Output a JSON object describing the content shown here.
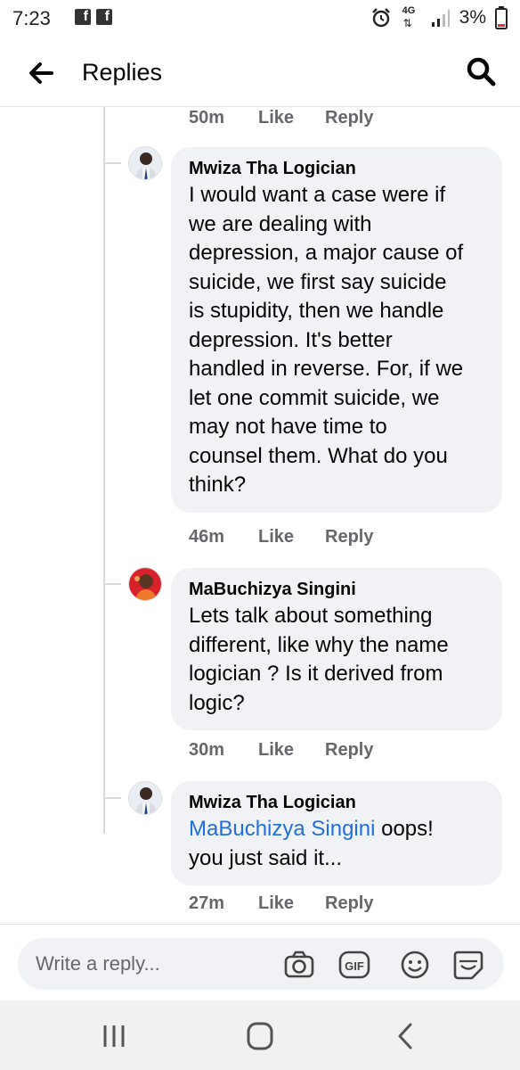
{
  "status_bar": {
    "time": "7:23",
    "network": "4G",
    "battery": "3%"
  },
  "header": {
    "title": "Replies",
    "back_icon": "arrow-left-icon",
    "search_icon": "search-icon"
  },
  "previous_meta": {
    "time": "50m",
    "like": "Like",
    "reply": "Reply"
  },
  "comments": [
    {
      "author": "Mwiza Tha Logician",
      "text": "I would want a case were if\nwe are dealing with\ndepression, a major cause of\nsuicide, we first say suicide\nis stupidity, then we handle\ndepression. It's better\nhandled in reverse. For, if we\nlet one commit suicide, we\nmay not have time to\ncounsel them. What do you\nthink?",
      "time": "46m",
      "like": "Like",
      "reply": "Reply"
    },
    {
      "author": "MaBuchizya Singini",
      "text": "Lets talk about something\ndifferent, like why the name\nlogician ? Is it derived from\nlogic?",
      "time": "30m",
      "like": "Like",
      "reply": "Reply"
    },
    {
      "author": "Mwiza Tha Logician",
      "mention": "MaBuchizya Singini",
      "text_after_mention": " oops!\nyou just said it...",
      "time": "27m",
      "like": "Like",
      "reply": "Reply"
    }
  ],
  "composer": {
    "placeholder": "Write a reply...",
    "icons": [
      "camera-icon",
      "gif-icon",
      "emoji-icon",
      "sticker-icon"
    ]
  },
  "nav_bar": {
    "icons": [
      "recent-apps-icon",
      "home-icon",
      "back-icon"
    ]
  },
  "colors": {
    "bubble": "#f0f2f5",
    "mention": "#216fdb",
    "meta": "#65676b"
  }
}
